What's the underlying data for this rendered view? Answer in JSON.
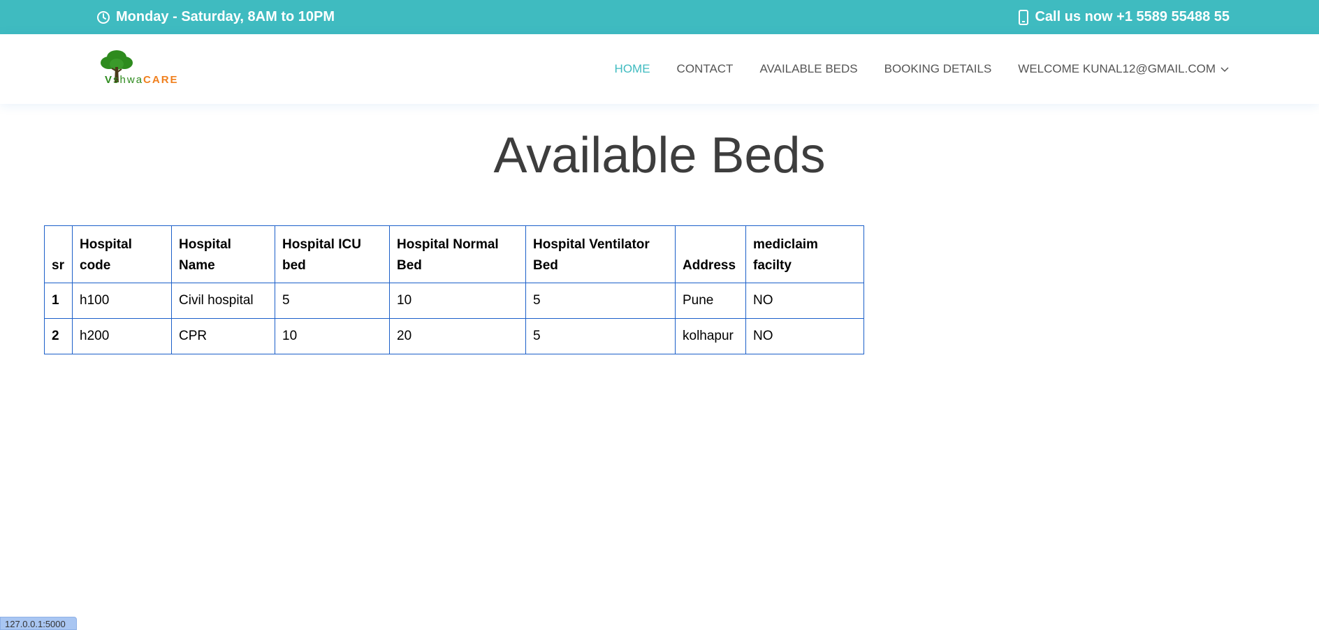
{
  "topbar": {
    "hours": "Monday - Saturday, 8AM to 10PM",
    "phone": "Call us now +1 5589 55488 55",
    "color": "#3fbbc0"
  },
  "logo": {
    "text_v": "V",
    "text_shwa": "shwa",
    "text_care": "CARE"
  },
  "nav": {
    "items": [
      {
        "label": "HOME",
        "active": true
      },
      {
        "label": "CONTACT",
        "active": false
      },
      {
        "label": "AVAILABLE BEDS",
        "active": false
      },
      {
        "label": "BOOKING DETAILS",
        "active": false
      },
      {
        "label": "WELCOME KUNAL12@GMAIL.COM",
        "active": false
      }
    ]
  },
  "page": {
    "title": "Available Beds"
  },
  "table": {
    "headers": [
      "sr",
      "Hospital code",
      "Hospital Name",
      "Hospital ICU bed",
      "Hospital Normal Bed",
      "Hospital Ventilator Bed",
      "Address",
      "mediclaim facilty"
    ],
    "rows": [
      [
        "1",
        "h100",
        "Civil hospital",
        "5",
        "10",
        "5",
        "Pune",
        "NO"
      ],
      [
        "2",
        "h200",
        "CPR",
        "10",
        "20",
        "5",
        "kolhapur",
        "NO"
      ]
    ]
  },
  "status": {
    "url": "127.0.0.1:5000"
  }
}
